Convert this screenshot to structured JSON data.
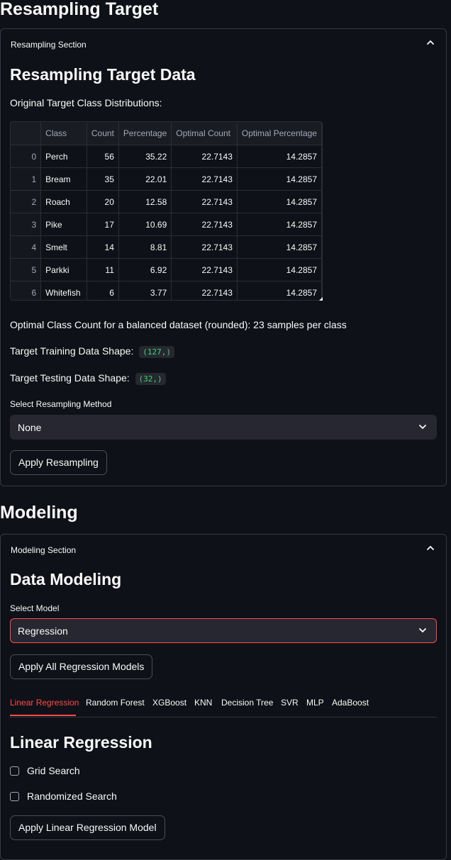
{
  "resampling": {
    "title": "Resampling Target",
    "section_label": "Resampling Section",
    "heading": "Resampling Target Data",
    "dist_label": "Original Target Class Distributions:",
    "table": {
      "columns": [
        "",
        "Class",
        "Count",
        "Percentage",
        "Optimal Count",
        "Optimal Percentage"
      ],
      "rows": [
        [
          "0",
          "Perch",
          "56",
          "35.22",
          "22.7143",
          "14.2857"
        ],
        [
          "1",
          "Bream",
          "35",
          "22.01",
          "22.7143",
          "14.2857"
        ],
        [
          "2",
          "Roach",
          "20",
          "12.58",
          "22.7143",
          "14.2857"
        ],
        [
          "3",
          "Pike",
          "17",
          "10.69",
          "22.7143",
          "14.2857"
        ],
        [
          "4",
          "Smelt",
          "14",
          "8.81",
          "22.7143",
          "14.2857"
        ],
        [
          "5",
          "Parkki",
          "11",
          "6.92",
          "22.7143",
          "14.2857"
        ],
        [
          "6",
          "Whitefish",
          "6",
          "3.77",
          "22.7143",
          "14.2857"
        ]
      ]
    },
    "optimal_text": "Optimal Class Count for a balanced dataset (rounded): 23 samples per class",
    "train_shape_label": "Target Training Data Shape:",
    "train_shape_value": "(127,)",
    "test_shape_label": "Target Testing Data Shape:",
    "test_shape_value": "(32,)",
    "method_label": "Select Resampling Method",
    "method_value": "None",
    "apply_button": "Apply Resampling"
  },
  "modeling": {
    "title": "Modeling",
    "section_label": "Modeling Section",
    "heading": "Data Modeling",
    "model_label": "Select Model",
    "model_value": "Regression",
    "apply_all_button": "Apply All Regression Models",
    "tabs": [
      "Linear Regression",
      "Random Forest",
      "XGBoost",
      "KNN",
      "Decision Tree",
      "SVR",
      "MLP",
      "AdaBoost"
    ],
    "active_tab": "Linear Regression",
    "sub_heading": "Linear Regression",
    "grid_search_label": "Grid Search",
    "random_search_label": "Randomized Search",
    "apply_model_button": "Apply Linear Regression Model"
  },
  "colors": {
    "background": "#0e1117",
    "accent": "#ff4b4b",
    "code_text": "#3dd56d",
    "input_bg": "#262730"
  },
  "icons": {
    "expander_toggle": "chevron-up-icon",
    "select_dropdown": "chevron-down-icon"
  }
}
